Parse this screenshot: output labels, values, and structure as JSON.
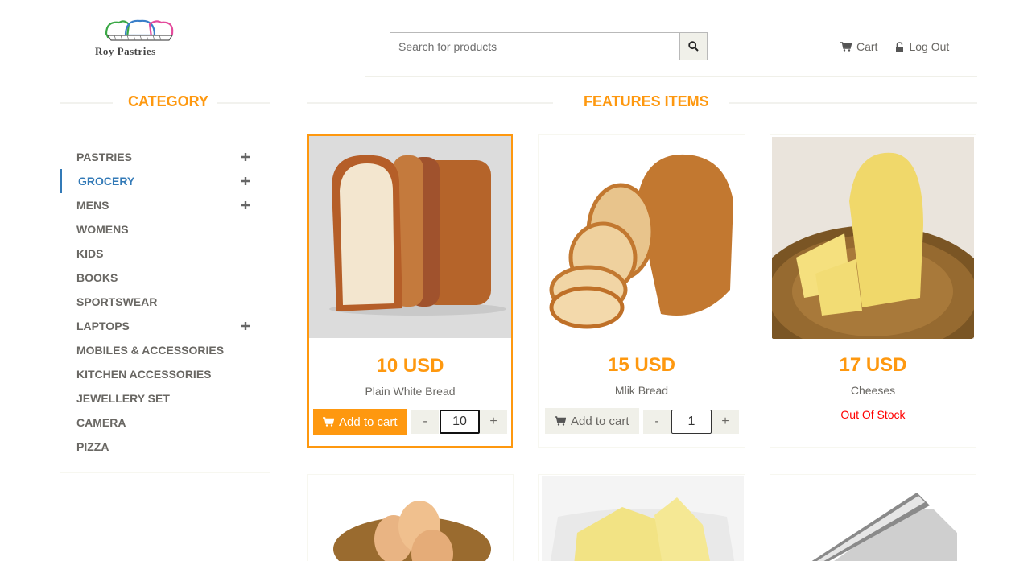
{
  "header": {
    "logo_text": "Roy Pastries",
    "search": {
      "placeholder": "Search for products",
      "value": ""
    },
    "nav": [
      {
        "label": "Cart",
        "icon": "cart-icon"
      },
      {
        "label": "Log Out",
        "icon": "lock-icon"
      }
    ]
  },
  "sidebar": {
    "title": "CATEGORY",
    "items": [
      {
        "label": "PASTRIES",
        "expandable": true
      },
      {
        "label": "GROCERY",
        "expandable": true,
        "active": true
      },
      {
        "label": "MENS",
        "expandable": true
      },
      {
        "label": "WOMENS",
        "expandable": false
      },
      {
        "label": "KIDS",
        "expandable": false
      },
      {
        "label": "BOOKS",
        "expandable": false
      },
      {
        "label": "SPORTSWEAR",
        "expandable": false
      },
      {
        "label": "LAPTOPS",
        "expandable": true
      },
      {
        "label": "MOBILES & ACCESSORIES",
        "expandable": false
      },
      {
        "label": "KITCHEN ACCESSORIES",
        "expandable": false
      },
      {
        "label": "JEWELLERY SET",
        "expandable": false
      },
      {
        "label": "CAMERA",
        "expandable": false
      },
      {
        "label": "PIZZA",
        "expandable": false
      }
    ]
  },
  "features": {
    "title": "FEATURES ITEMS",
    "add_to_cart_label": "Add to cart",
    "minus_label": "-",
    "plus_label": "+",
    "products": [
      {
        "price": "10 USD",
        "name": "Plain White Bread",
        "qty": "10",
        "status": "in-stock",
        "image": "sliced-white-bread"
      },
      {
        "price": "15 USD",
        "name": "Mlik Bread",
        "qty": "1",
        "status": "in-stock",
        "image": "sliced-milk-bread"
      },
      {
        "price": "17 USD",
        "name": "Cheeses",
        "status_text": "Out Of Stock",
        "status": "out-of-stock",
        "image": "cheese-wedge"
      }
    ],
    "more_products": [
      {
        "image": "eggs-basket"
      },
      {
        "image": "butter-dish"
      },
      {
        "image": "aluminium-foil-roll"
      }
    ]
  },
  "colors": {
    "accent": "#fe980f",
    "active_link": "#337ab7",
    "text": "#696763",
    "out_of_stock": "#ff0000",
    "button_grey": "#f0f0e9"
  }
}
